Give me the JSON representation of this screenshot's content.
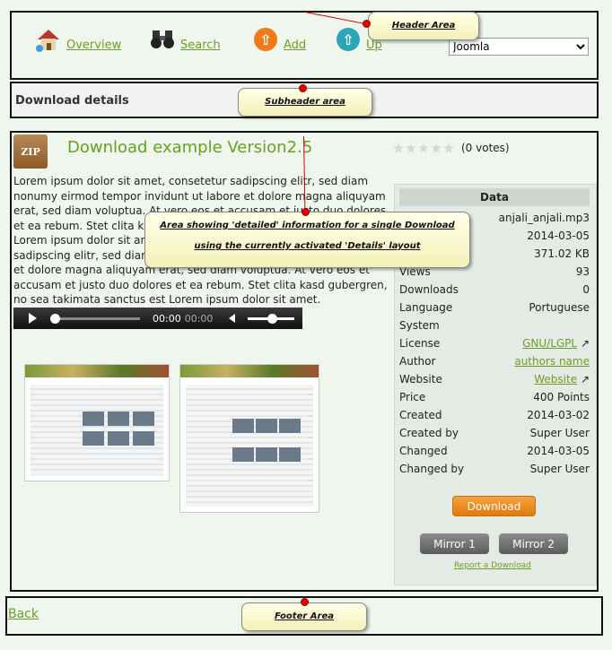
{
  "header": {
    "nav": [
      {
        "label": "Overview",
        "icon": "home-icon"
      },
      {
        "label": "Search",
        "icon": "binoculars-icon"
      },
      {
        "label": "Add",
        "icon": "upload-arrow-icon"
      },
      {
        "label": "Up",
        "icon": "up-arrow-icon"
      }
    ],
    "category_select": "Joomla"
  },
  "subheader": {
    "title": "Download details"
  },
  "download": {
    "title": "Download example Version2.5",
    "votes": "(0 votes)",
    "description": "Lorem ipsum dolor sit amet, consetetur sadipscing elitr, sed diam nonumy eirmod tempor invidunt ut labore et dolore magna aliquyam erat, sed diam voluptua. At vero eos et accusam et justo duo dolores et ea rebum. Stet clita kasd gubergren, no sea takimata sanctus est Lorem ipsum dolor sit amet. Lorem ipsum dolor sit amet, consetetur sadipscing elitr, sed diam nonumy eirmod tempor invidunt ut labore et dolore magna aliquyam erat, sed diam voluptua. At vero eos et accusam et justo duo dolores et ea rebum. Stet clita kasd gubergren, no sea takimata sanctus est Lorem ipsum dolor sit amet.",
    "player": {
      "current_time": "00:00",
      "duration": "00:00"
    }
  },
  "data_panel": {
    "heading": "Data",
    "rows": [
      {
        "label": "",
        "value": "anjali_anjali.mp3"
      },
      {
        "label": "",
        "value": "2014-03-05"
      },
      {
        "label": "",
        "value": "371.02 KB"
      },
      {
        "label": "Views",
        "value": "93"
      },
      {
        "label": "Downloads",
        "value": "0"
      },
      {
        "label": "Language",
        "value": "Portuguese"
      },
      {
        "label": "System",
        "value": ""
      },
      {
        "label": "License",
        "value": "GNU/LGPL"
      },
      {
        "label": "Author",
        "value": "authors name"
      },
      {
        "label": "Website",
        "value": "Website"
      },
      {
        "label": "Price",
        "value": "400 Points"
      },
      {
        "label": "Created",
        "value": "2014-03-02"
      },
      {
        "label": "Created by",
        "value": "Super User"
      },
      {
        "label": "Changed",
        "value": "2014-03-05"
      },
      {
        "label": "Changed by",
        "value": "Super User"
      }
    ],
    "download_button": "Download",
    "mirror1": "Mirror 1",
    "mirror2": "Mirror 2",
    "report_link": "Report a Download"
  },
  "footer": {
    "back": "Back"
  },
  "callouts": {
    "header": "Header Area",
    "subheader": "Subheader area",
    "details_line1": "Area showing 'detailed' information for a single Download",
    "details_line2": "using the currently activated 'Details' layout",
    "footer": "Footer Area"
  },
  "colors": {
    "accent": "#6aa022",
    "callout_dot": "#e00000",
    "download_button": "#f08c1e"
  }
}
